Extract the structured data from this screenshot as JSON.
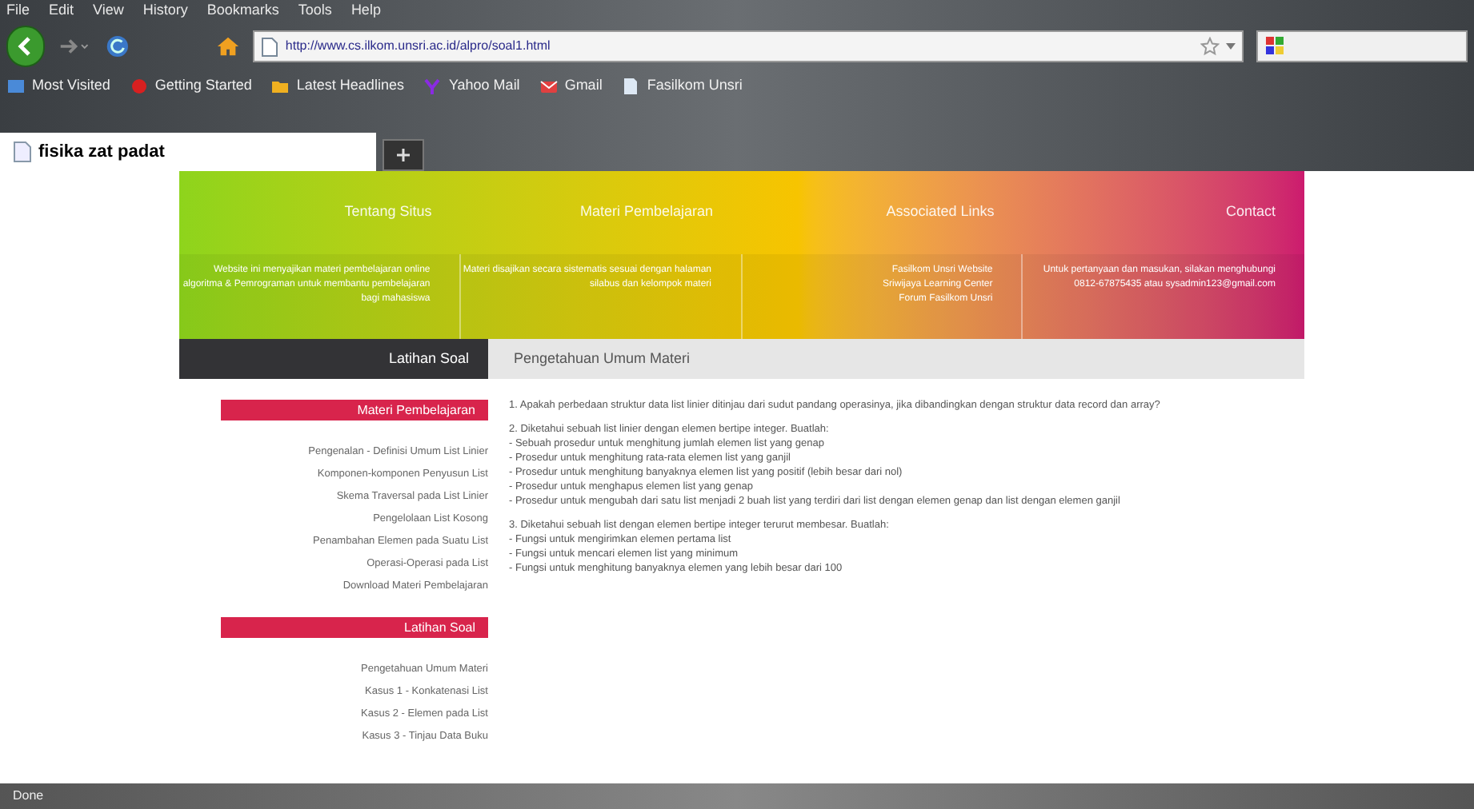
{
  "menu_bar": [
    "File",
    "Edit",
    "View",
    "History",
    "Bookmarks",
    "Tools",
    "Help"
  ],
  "address_bar": {
    "url": "http://www.cs.ilkom.unsri.ac.id/alpro/soal1.html"
  },
  "bookmarks": [
    {
      "label": "Most Visited",
      "kind": "blue"
    },
    {
      "label": "Getting Started",
      "kind": "red"
    },
    {
      "label": "Latest Headlines",
      "kind": "folder"
    },
    {
      "label": "Yahoo Mail",
      "kind": "yahoo"
    },
    {
      "label": "Gmail",
      "kind": "mail"
    },
    {
      "label": "Fasilkom Unsri",
      "kind": "page"
    }
  ],
  "tabs": [
    {
      "label": "fisika zat padat",
      "selected": true
    }
  ],
  "header": {
    "columns": [
      {
        "title": "Tentang Situs",
        "text": "Website ini menyajikan materi pembelajaran online algoritma & Pemrograman untuk membantu pembelajaran bagi mahasiswa"
      },
      {
        "title": "Materi Pembelajaran",
        "text": "Materi disajikan secara sistematis sesuai dengan halaman silabus dan kelompok materi"
      },
      {
        "title": "Associated Links",
        "text": "Fasilkom Unsri Website\nSriwijaya Learning Center\nForum Fasilkom Unsri"
      },
      {
        "title": "Contact",
        "text": "Untuk pertanyaan dan masukan, silakan menghubungi 0812-67875435 atau sysadmin123@gmail.com"
      }
    ]
  },
  "section_bar": {
    "left": "Latihan Soal",
    "right": "Pengetahuan Umum Materi"
  },
  "sidebar": [
    {
      "heading": "Materi Pembelajaran",
      "items": [
        "Pengenalan - Definisi Umum List Linier",
        "Komponen-komponen Penyusun List",
        "Skema Traversal pada List Linier",
        "Pengelolaan List Kosong",
        "Penambahan Elemen pada Suatu List",
        "Operasi-Operasi pada List",
        "Download Materi Pembelajaran"
      ]
    },
    {
      "heading": "Latihan Soal",
      "items": [
        "Pengetahuan Umum Materi",
        "Kasus 1 - Konkatenasi List",
        "Kasus 2 - Elemen pada List",
        "Kasus 3 - Tinjau Data Buku"
      ]
    }
  ],
  "questions": [
    {
      "lines": [
        "1. Apakah perbedaan struktur data list linier ditinjau dari sudut pandang operasinya, jika dibandingkan dengan struktur data record dan array?"
      ]
    },
    {
      "lines": [
        "2. Diketahui sebuah list linier dengan elemen bertipe integer. Buatlah:",
        "- Sebuah prosedur untuk menghitung jumlah elemen list yang genap",
        "- Prosedur untuk menghitung rata-rata elemen list yang ganjil",
        "- Prosedur untuk menghitung banyaknya elemen list yang positif (lebih besar dari nol)",
        "- Prosedur untuk menghapus elemen list yang genap",
        "- Prosedur untuk mengubah dari satu list menjadi 2 buah list yang terdiri dari list dengan elemen genap dan list dengan elemen ganjil"
      ]
    },
    {
      "lines": [
        "3. Diketahui sebuah list dengan elemen bertipe integer terurut membesar. Buatlah:",
        "- Fungsi untuk mengirimkan elemen pertama list",
        "- Fungsi untuk mencari elemen list yang minimum",
        "- Fungsi untuk menghitung banyaknya elemen yang lebih besar dari 100"
      ]
    }
  ],
  "status_bar": "Done"
}
